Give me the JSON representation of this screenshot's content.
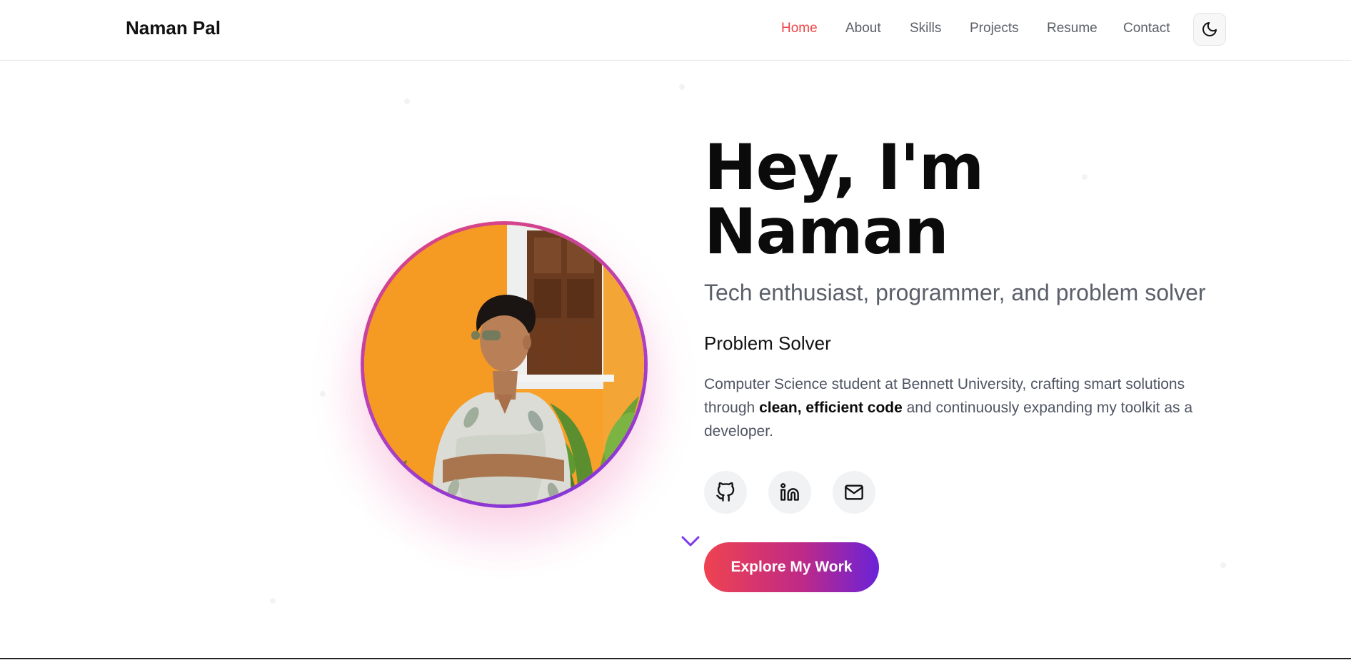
{
  "brand": "Naman Pal",
  "nav": {
    "links": [
      {
        "label": "Home",
        "active": true
      },
      {
        "label": "About",
        "active": false
      },
      {
        "label": "Skills",
        "active": false
      },
      {
        "label": "Projects",
        "active": false
      },
      {
        "label": "Resume",
        "active": false
      },
      {
        "label": "Contact",
        "active": false
      }
    ],
    "theme_icon": "moon-icon"
  },
  "hero": {
    "title_line1": "Hey, I'm",
    "title_line2": "Naman",
    "tagline": "Tech enthusiast, programmer, and problem solver",
    "role": "Problem Solver",
    "bio_before": "Computer Science student at Bennett University, crafting smart solutions through ",
    "bio_bold": "clean, efficient code",
    "bio_after": " and continuously expanding my toolkit as a developer.",
    "portrait_icon": "profile-photo",
    "social": [
      {
        "name": "github",
        "icon": "github-icon"
      },
      {
        "name": "linkedin",
        "icon": "linkedin-icon"
      },
      {
        "name": "email",
        "icon": "mail-icon"
      }
    ],
    "scroll_icon": "chevron-down-icon",
    "cta_label": "Explore My Work"
  },
  "colors": {
    "accent_red": "#ef4444",
    "gradient_start": "#ef4350",
    "gradient_end": "#6a22d8",
    "ring_pink": "#e0457b",
    "ring_purple": "#7a34e0"
  }
}
